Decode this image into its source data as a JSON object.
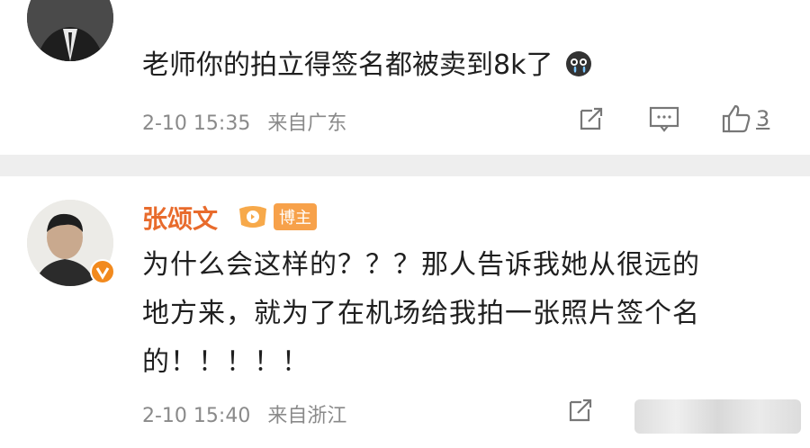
{
  "comments": [
    {
      "text": "老师你的拍立得签名都被卖到8k了",
      "emoji": "crying-face-icon",
      "time": "2-10 15:35",
      "source": "来自广东",
      "likes": "3"
    },
    {
      "username": "张颂文",
      "badge": "博主",
      "line1": "为什么会这样的？？？那人告诉我她从很远的",
      "line2": "地方来，就为了在机场给我拍一张照片签个名",
      "line3": "的！！！！！",
      "time": "2-10 15:40",
      "source": "来自浙江"
    }
  ],
  "colors": {
    "username": "#e86b2c",
    "verified": "#f28a1e",
    "divider": "#eeeeee"
  }
}
